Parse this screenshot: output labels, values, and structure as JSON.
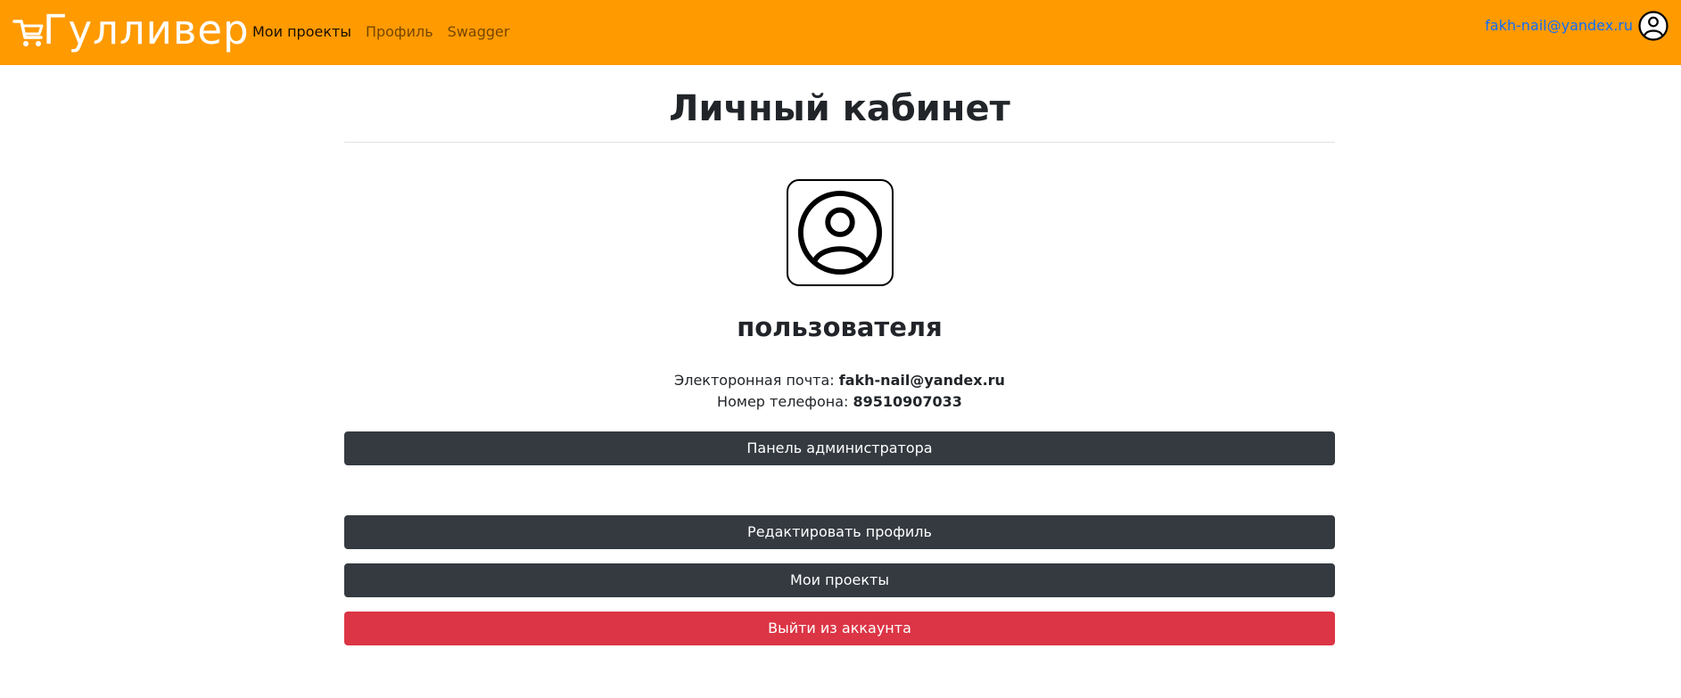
{
  "colors": {
    "accent": "#ff9a00",
    "dark": "#343a40",
    "danger": "#dc3545",
    "link": "#0d6efd"
  },
  "brand": {
    "name": "Гулливер",
    "icon": "shopping-cart-icon"
  },
  "nav": {
    "items": [
      {
        "label": "Мои проекты",
        "active": true
      },
      {
        "label": "Профиль",
        "active": false
      },
      {
        "label": "Swagger",
        "active": false
      }
    ]
  },
  "user": {
    "email": "fakh-nail@yandex.ru",
    "avatar_icon": "user-circle-icon"
  },
  "page": {
    "title": "Личный кабинет",
    "avatar_icon": "user-circle-icon",
    "username": "пользователя",
    "email_label": "Электоронная почта: ",
    "email_value": "fakh-nail@yandex.ru",
    "phone_label": "Номер телефона: ",
    "phone_value": "89510907033"
  },
  "buttons": {
    "admin": "Панель администратора",
    "edit_profile": "Редактировать профиль",
    "my_projects": "Мои проекты",
    "logout": "Выйти из аккаунта"
  }
}
